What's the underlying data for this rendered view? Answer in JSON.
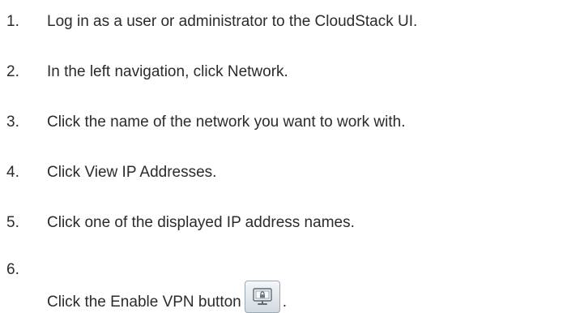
{
  "steps": [
    {
      "num": "1.",
      "text": "Log in as a user or administrator to the CloudStack UI."
    },
    {
      "num": "2.",
      "text": "In the left navigation, click Network."
    },
    {
      "num": "3.",
      "text": "Click the name of the network you want to work with."
    },
    {
      "num": "4.",
      "text": "Click View IP Addresses."
    },
    {
      "num": "5.",
      "text": "Click one of the displayed IP address names."
    },
    {
      "num": "6.",
      "text": "Click the Enable VPN button",
      "trailing": "."
    }
  ],
  "icons": {
    "enable_vpn": "monitor-lock-icon"
  }
}
